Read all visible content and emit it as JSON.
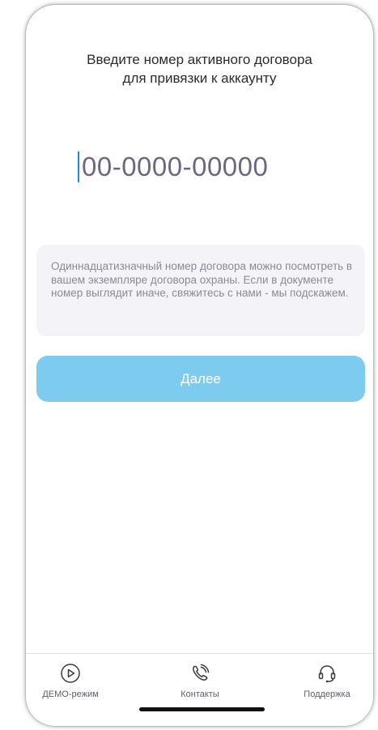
{
  "prompt": {
    "line1": "Введите номер активного договора",
    "line2": "для привязки к аккаунту"
  },
  "contract_input": {
    "placeholder": "00-0000-00000",
    "value": ""
  },
  "hint": {
    "text": "Одиннадцатизначный номер договора можно посмотреть в вашем экземпляре договора охраны. Если в документе номер выглядит иначе, свяжитесь с нами - мы подскажем."
  },
  "next_button": {
    "label": "Далее"
  },
  "tabbar": {
    "items": [
      {
        "label": "ДЕМО-режим",
        "icon": "play-circle-icon"
      },
      {
        "label": "Контакты",
        "icon": "phone-call-icon"
      },
      {
        "label": "Поддержка",
        "icon": "headset-icon"
      }
    ]
  },
  "colors": {
    "accent_button": "#7dcbef",
    "caret": "#1e88e5",
    "placeholder_text": "#6a6884",
    "hint_background": "#f4f4f8"
  }
}
